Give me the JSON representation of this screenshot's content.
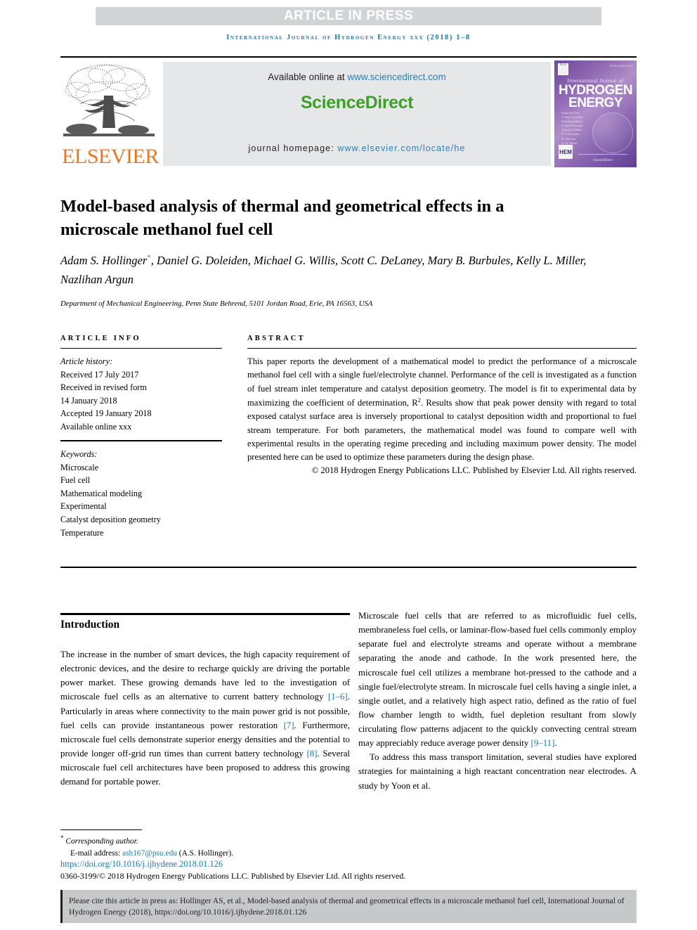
{
  "banner": {
    "text": "ARTICLE IN PRESS"
  },
  "running_head": {
    "text": "International Journal of Hydrogen Energy xxx (2018) 1–8"
  },
  "publisher": {
    "name": "ELSEVIER",
    "logo_icon": "elsevier-tree-logo",
    "accent_color": "#e87722"
  },
  "sciencedirect": {
    "available_prefix": "Available online at ",
    "available_url": "www.sciencedirect.com",
    "logo_text": "ScienceDirect",
    "logo_color": "#3da028",
    "homepage_prefix": "journal homepage: ",
    "homepage_url": "www.elsevier.com/locate/he",
    "link_color": "#2e7fb5",
    "panel_color": "#e6e7e8"
  },
  "cover": {
    "elsevier_mark": "ELS",
    "issn": "ISSN 0360-3199",
    "line_small": "International Journal of",
    "line_big_1": "HYDROGEN",
    "line_big_2": "ENERGY",
    "editors_block": "Editor-in-Chief\nT. Nejat Veziroglu\nFounding Editors\nT. Nejat Veziroglu\nAssociate Editors\nD. Y. Goswami\nM. Hirscher\nA. M. Dincer\nE. Kjeang\nS. Dunn",
    "hem_mark": "HEM",
    "sciencedirect_footer": "ScienceDirect"
  },
  "article": {
    "title": "Model-based analysis of thermal and geometrical effects in a microscale methanol fuel cell",
    "authors": "Adam S. Hollinger, Daniel G. Doleiden, Michael G. Willis, Scott C. DeLaney, Mary B. Burbules, Kelly L. Miller, Nazlihan Argun",
    "authors_part1": "Adam S. Hollinger",
    "corresponding_marker": "*",
    "authors_part2": ", Daniel G. Doleiden, Michael G. Willis, Scott C. DeLaney, Mary B. Burbules, Kelly L. Miller, Nazlihan Argun",
    "affiliation": "Department of Mechanical Engineering, Penn State Behrend, 5101 Jordan Road, Erie, PA 16563, USA"
  },
  "article_info": {
    "heading": "ARTICLE INFO",
    "history_label": "Article history:",
    "history": [
      "Received 17 July 2017",
      "Received in revised form",
      "14 January 2018",
      "Accepted 19 January 2018",
      "Available online xxx"
    ],
    "keywords_label": "Keywords:",
    "keywords": [
      "Microscale",
      "Fuel cell",
      "Mathematical modeling",
      "Experimental",
      "Catalyst deposition geometry",
      "Temperature"
    ]
  },
  "abstract": {
    "heading": "ABSTRACT",
    "body_part1": "This paper reports the development of a mathematical model to predict the performance of a microscale methanol fuel cell with a single fuel/electrolyte channel. Performance of the cell is investigated as a function of fuel stream inlet temperature and catalyst deposition geometry. The model is fit to experimental data by maximizing the coefficient of determination, R",
    "body_superscript": "2",
    "body_part2": ". Results show that peak power density with regard to total exposed catalyst surface area is inversely proportional to catalyst deposition width and proportional to fuel stream temperature. For both parameters, the mathematical model was found to compare well with experimental results in the operating regime preceding and including maximum power density. The model presented here can be used to optimize these parameters during the design phase.",
    "copyright": "© 2018 Hydrogen Energy Publications LLC. Published by Elsevier Ltd. All rights reserved."
  },
  "introduction": {
    "heading": "Introduction",
    "left_column_part1": "The increase in the number of smart devices, the high capacity requirement of electronic devices, and the desire to recharge quickly are driving the portable power market. These growing demands have led to the investigation of microscale fuel cells as an alternative to current battery technology ",
    "ref_1_6": "[1–6]",
    "left_column_part2": ". Particularly in areas where connectivity to the main power grid is not possible, fuel cells can provide instantaneous power restoration ",
    "ref_7": "[7]",
    "left_column_part3": ". Furthermore, microscale fuel cells demonstrate superior energy densities and the potential to provide longer off-grid run times than current battery technology ",
    "ref_8": "[8]",
    "left_column_part4": ". Several microscale fuel cell architectures have been proposed to address this growing demand for portable power.",
    "right_paragraph_1a": "Microscale fuel cells that are referred to as microfluidic fuel cells, membraneless fuel cells, or laminar-flow-based fuel cells commonly employ separate fuel and electrolyte streams and operate without a membrane separating the anode and cathode. In the work presented here, the microscale fuel cell utilizes a membrane hot-pressed to the cathode and a single fuel/electrolyte stream. In microscale fuel cells having a single inlet, a single outlet, and a relatively high aspect ratio, defined as the ratio of fuel flow chamber length to width, fuel depletion resultant from slowly circulating flow patterns adjacent to the quickly convecting central stream may appreciably reduce average power density ",
    "ref_9_11": "[9–11]",
    "right_paragraph_1b": ".",
    "right_paragraph_2": "To address this mass transport limitation, several studies have explored strategies for maintaining a high reactant concentration near electrodes. A study by Yoon et al."
  },
  "footer": {
    "corresponding_star": "*",
    "corresponding_label": "Corresponding author.",
    "email_label": "E-mail address: ",
    "email": "ash167@psu.edu",
    "email_owner": " (A.S. Hollinger).",
    "doi": "https://doi.org/10.1016/j.ijhydene.2018.01.126",
    "issn_line": "0360-3199/© 2018 Hydrogen Energy Publications LLC. Published by Elsevier Ltd. All rights reserved.",
    "link_color": "#1a7ba4"
  },
  "citation_box": {
    "text": "Please cite this article in press as: Hollinger AS, et al., Model-based analysis of thermal and geometrical effects in a microscale methanol fuel cell, International Journal of Hydrogen Energy (2018), https://doi.org/10.1016/j.ijhydene.2018.01.126",
    "background": "#c7c8ca"
  }
}
